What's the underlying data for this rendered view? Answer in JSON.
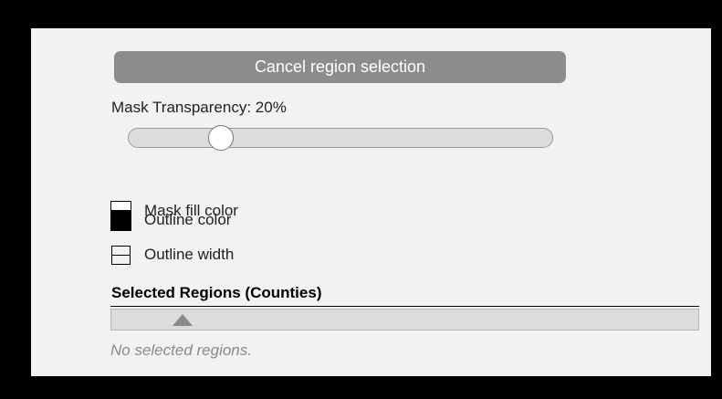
{
  "panel": {
    "cancel_button_label": "Cancel region selection",
    "transparency": {
      "label": "Mask Transparency: 20%",
      "value_percent": 20,
      "slider_fraction": 0.2
    },
    "options": [
      {
        "label": "Mask fill color",
        "swatch": "#ffffff",
        "icon": "white-color-swatch"
      },
      {
        "label": "Outline color",
        "swatch": "#000000",
        "icon": "black-color-swatch"
      },
      {
        "label": "Outline width",
        "icon": "outline-width-icon"
      }
    ],
    "regions": {
      "title": "Selected Regions (Counties)",
      "expand_icon": "triangle-up-icon",
      "empty_message": "No selected regions."
    }
  },
  "colors": {
    "background": "#000000",
    "panel": "#f2f2f2",
    "button": "#8c8c8c",
    "muted_text": "#8a8a8a"
  }
}
